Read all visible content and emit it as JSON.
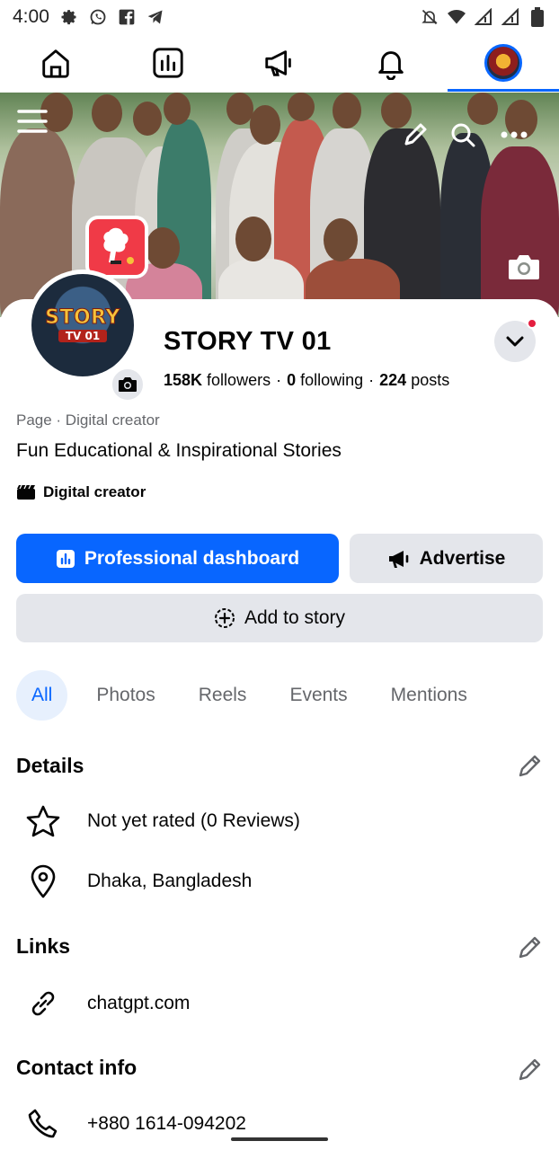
{
  "status_bar": {
    "time": "4:00",
    "left_icons": [
      "gear-icon",
      "whatsapp-icon",
      "facebook-icon",
      "telegram-icon"
    ],
    "right_icons": [
      "bell-muted-icon",
      "wifi-icon",
      "signal-icon",
      "signal-icon",
      "battery-icon"
    ]
  },
  "top_nav": {
    "tabs": [
      {
        "name": "home",
        "icon": "home-icon"
      },
      {
        "name": "dashboard",
        "icon": "dashboard-icon"
      },
      {
        "name": "ads",
        "icon": "megaphone-icon"
      },
      {
        "name": "notifications",
        "icon": "bell-icon"
      },
      {
        "name": "profile",
        "icon": "avatar",
        "active": true
      }
    ]
  },
  "profile": {
    "name": "STORY TV 01",
    "logo_line1": "STORY",
    "logo_line2": "TV 01",
    "followers_count": "158K",
    "followers_label": "followers",
    "following_count": "0",
    "following_label": "following",
    "posts_count": "224",
    "posts_label": "posts",
    "category": "Page · Digital creator",
    "bio": "Fun Educational & Inspirational Stories",
    "creator_badge": "Digital creator"
  },
  "buttons": {
    "dashboard": "Professional dashboard",
    "advertise": "Advertise",
    "add_story": "Add to story"
  },
  "tabs": [
    "All",
    "Photos",
    "Reels",
    "Events",
    "Mentions"
  ],
  "details": {
    "title": "Details",
    "rating": "Not yet rated (0 Reviews)",
    "location": "Dhaka, Bangladesh"
  },
  "links": {
    "title": "Links",
    "website": "chatgpt.com"
  },
  "contact": {
    "title": "Contact info",
    "phone": "+880 1614-094202"
  },
  "colors": {
    "accent": "#0866ff",
    "button_gray": "#e4e6eb",
    "notification_dot": "#e41e3f"
  }
}
